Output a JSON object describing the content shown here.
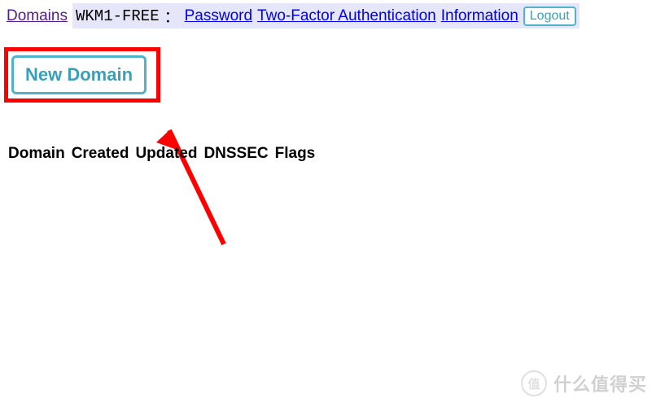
{
  "nav": {
    "domains_label": "Domains",
    "username": "WKM1-FREE",
    "colon": "：",
    "links": {
      "password": "Password",
      "twofa": "Two-Factor Authentication",
      "information": "Information"
    },
    "logout_label": "Logout"
  },
  "actions": {
    "new_domain_label": "New Domain"
  },
  "table": {
    "headers": {
      "domain": "Domain",
      "created": "Created",
      "updated": "Updated",
      "dnssec": "DNSSEC",
      "flags": "Flags"
    }
  },
  "watermark": {
    "badge": "值",
    "text": "什么值得买"
  }
}
